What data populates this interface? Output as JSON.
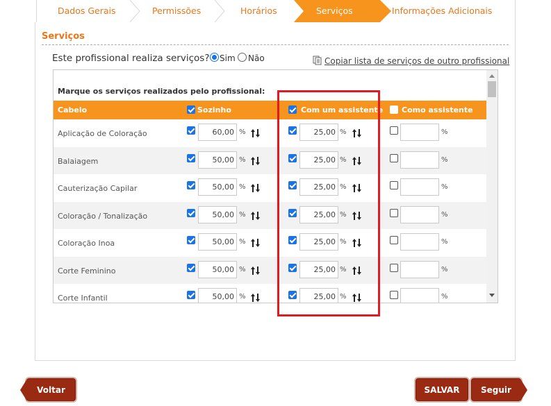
{
  "tabs": [
    {
      "label": "Dados Gerais"
    },
    {
      "label": "Permissões"
    },
    {
      "label": "Horários"
    },
    {
      "label": "Serviços",
      "active": true
    },
    {
      "label": "Informações Adicionais"
    }
  ],
  "section": {
    "title": "Serviços"
  },
  "question": {
    "text": "Este profissional realiza serviços?",
    "yes_label": "Sim",
    "no_label": "Não",
    "selected": "Sim"
  },
  "copy_link": {
    "label": "Copiar lista de serviços de outro profissional",
    "icon": "copy-icon"
  },
  "table": {
    "instruction": "Marque os serviços realizados pelo profissional:",
    "header": {
      "category": "Cabelo",
      "col_alone": "Sozinho",
      "col_with_assistant": "Com um assistente",
      "col_as_assistant": "Como assistente",
      "alone_checked": true,
      "with_assistant_checked": true,
      "as_assistant_checked": false
    },
    "rows": [
      {
        "name": "Aplicação de Coloração",
        "alone": "60,00",
        "with_assistant": "25,00",
        "as_assistant": ""
      },
      {
        "name": "Balaiagem",
        "alone": "50,00",
        "with_assistant": "25,00",
        "as_assistant": ""
      },
      {
        "name": "Cauterização Capilar",
        "alone": "50,00",
        "with_assistant": "25,00",
        "as_assistant": ""
      },
      {
        "name": "Coloração / Tonalização",
        "alone": "50,00",
        "with_assistant": "25,00",
        "as_assistant": ""
      },
      {
        "name": "Coloração Inoa",
        "alone": "50,00",
        "with_assistant": "25,00",
        "as_assistant": ""
      },
      {
        "name": "Corte Feminino",
        "alone": "50,00",
        "with_assistant": "25,00",
        "as_assistant": ""
      },
      {
        "name": "Corte Infantil",
        "alone": "50,00",
        "with_assistant": "25,00",
        "as_assistant": ""
      }
    ],
    "percent_symbol": "%"
  },
  "buttons": {
    "back": "Voltar",
    "save": "SALVAR",
    "next": "Seguir"
  },
  "colors": {
    "accent": "#f7941d",
    "accent_text": "#e8771a",
    "button": "#9b2a12",
    "highlight": "#e21b23",
    "checkbox": "#1a73e8"
  }
}
